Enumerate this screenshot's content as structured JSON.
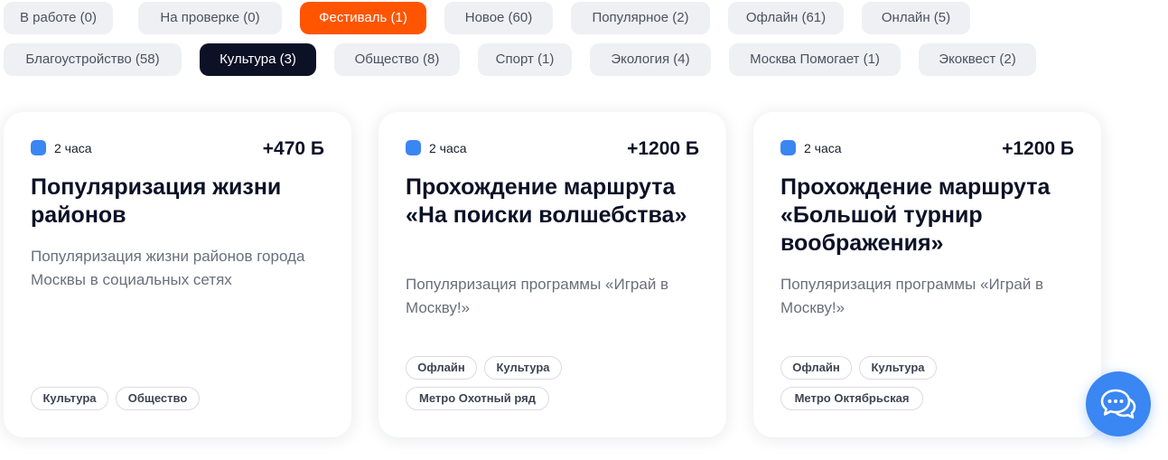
{
  "filters": [
    {
      "label": "В работе (0)"
    },
    {
      "label": "На проверке (0)"
    },
    {
      "label": "Фестиваль (1)"
    },
    {
      "label": "Новое (60)"
    },
    {
      "label": "Популярное (2)"
    },
    {
      "label": "Офлайн (61)"
    },
    {
      "label": "Онлайн (5)"
    },
    {
      "label": "Благоустройство (58)"
    },
    {
      "label": "Культура (3)"
    },
    {
      "label": "Общество (8)"
    },
    {
      "label": "Спорт (1)"
    },
    {
      "label": "Экология (4)"
    },
    {
      "label": "Москва Помогает (1)"
    },
    {
      "label": "Экоквест (2)"
    }
  ],
  "colors": {
    "accent_orange": "#ff5500",
    "selected_dark": "#0c1126",
    "chip_bg": "#eef0f3",
    "duration_marker": "#3a86f2",
    "chat_button": "#3a86f2"
  },
  "cards": [
    {
      "duration": "2 часа",
      "points": "+470 Б",
      "title": "Популяризация жизни районов",
      "description": "Популяризация жизни районов города Москвы в социальных сетях",
      "tags": [
        "Культура",
        "Общество"
      ]
    },
    {
      "duration": "2 часа",
      "points": "+1200 Б",
      "title": "Прохождение маршрута «На поиски волшебства»",
      "description": "Популяризация программы «Играй в Москву!»",
      "tags": [
        "Офлайн",
        "Культура",
        "Метро Охотный ряд"
      ]
    },
    {
      "duration": "2 часа",
      "points": "+1200 Б",
      "title": "Прохождение маршрута «Большой турнир воображения»",
      "description": "Популяризация программы «Играй в Москву!»",
      "tags": [
        "Офлайн",
        "Культура",
        "Метро Октябрьская"
      ]
    }
  ],
  "chat": {
    "icon": "chat-bubbles-icon"
  }
}
